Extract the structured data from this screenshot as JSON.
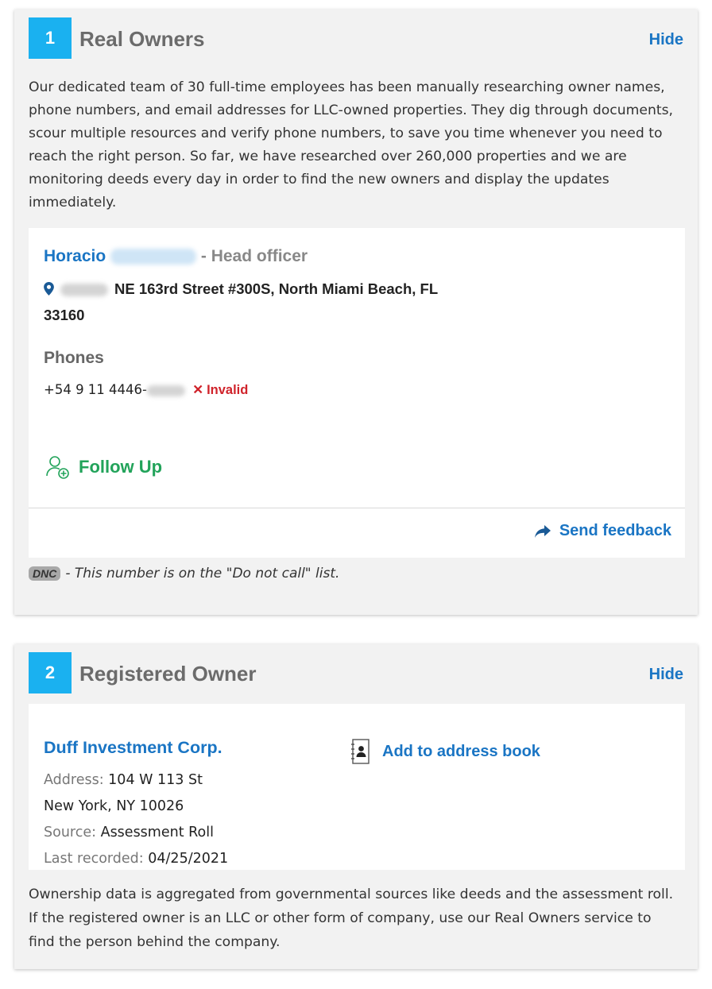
{
  "real_owners": {
    "number": "1",
    "title": "Real Owners",
    "hide_label": "Hide",
    "intro": "Our dedicated team of 30 full-time employees has been manually researching owner names, phone numbers, and email addresses for LLC-owned properties. They dig through documents, scour multiple resources and verify phone numbers, to save you time whenever you need to reach the right person. So far, we have researched over 260,000 properties and we are monitoring deeds every day in order to find the new owners and display the updates immediately.",
    "owner": {
      "first_name": "Horacio",
      "role": "- Head officer",
      "address_line1": "NE 163rd Street #300S, North Miami Beach, FL",
      "address_line2": "33160",
      "phones_title": "Phones",
      "phone_prefix": "+54 9 11 4446-",
      "phone_status": "Invalid"
    },
    "follow_up_label": "Follow Up",
    "feedback_label": "Send feedback",
    "dnc_badge": "DNC",
    "dnc_text": "- This number is on the \"Do not call\" list."
  },
  "registered_owner": {
    "number": "2",
    "title": "Registered Owner",
    "hide_label": "Hide",
    "name": "Duff Investment Corp.",
    "add_book_label": "Add to address book",
    "address_label": "Address:",
    "address_line1": "104 W 113 St",
    "address_line2": "New York, NY 10026",
    "source_label": "Source:",
    "source_value": "Assessment Roll",
    "recorded_label": "Last recorded:",
    "recorded_value": "04/25/2021",
    "note": "Ownership data is aggregated from governmental sources like deeds and the assessment roll. If the registered owner is an LLC or other form of company, use our Real Owners service to find the person behind the company."
  },
  "colors": {
    "badge": "#1ab1f0",
    "link": "#1a75c4",
    "follow": "#22a35a",
    "invalid": "#d0232b"
  },
  "icons": {
    "location": "map-pin-icon",
    "invalid": "x-icon",
    "follow": "user-add-icon",
    "feedback": "share-arrow-icon",
    "address_book": "address-book-icon"
  }
}
